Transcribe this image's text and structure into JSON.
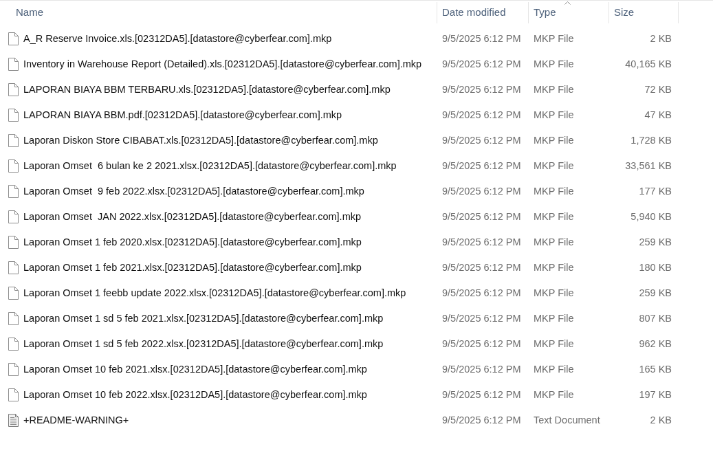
{
  "table": {
    "columns": [
      {
        "label": "Name",
        "sorted": false
      },
      {
        "label": "Date modified",
        "sorted": false
      },
      {
        "label": "Type",
        "sorted": true
      },
      {
        "label": "Size",
        "sorted": false
      }
    ],
    "rows": [
      {
        "kind": "file",
        "name": "A_R Reserve Invoice.xls.[02312DA5].[datastore@cyberfear.com].mkp",
        "date": "9/5/2025 6:12 PM",
        "type": "MKP File",
        "size": "2 KB"
      },
      {
        "kind": "file",
        "name": "Inventory in Warehouse Report (Detailed).xls.[02312DA5].[datastore@cyberfear.com].mkp",
        "date": "9/5/2025 6:12 PM",
        "type": "MKP File",
        "size": "40,165 KB"
      },
      {
        "kind": "file",
        "name": "LAPORAN BIAYA BBM TERBARU.xls.[02312DA5].[datastore@cyberfear.com].mkp",
        "date": "9/5/2025 6:12 PM",
        "type": "MKP File",
        "size": "72 KB"
      },
      {
        "kind": "file",
        "name": "LAPORAN BIAYA BBM.pdf.[02312DA5].[datastore@cyberfear.com].mkp",
        "date": "9/5/2025 6:12 PM",
        "type": "MKP File",
        "size": "47 KB"
      },
      {
        "kind": "file",
        "name": "Laporan Diskon Store CIBABAT.xls.[02312DA5].[datastore@cyberfear.com].mkp",
        "date": "9/5/2025 6:12 PM",
        "type": "MKP File",
        "size": "1,728 KB"
      },
      {
        "kind": "file",
        "name": "Laporan Omset  6 bulan ke 2 2021.xlsx.[02312DA5].[datastore@cyberfear.com].mkp",
        "date": "9/5/2025 6:12 PM",
        "type": "MKP File",
        "size": "33,561 KB"
      },
      {
        "kind": "file",
        "name": "Laporan Omset  9 feb 2022.xlsx.[02312DA5].[datastore@cyberfear.com].mkp",
        "date": "9/5/2025 6:12 PM",
        "type": "MKP File",
        "size": "177 KB"
      },
      {
        "kind": "file",
        "name": "Laporan Omset  JAN 2022.xlsx.[02312DA5].[datastore@cyberfear.com].mkp",
        "date": "9/5/2025 6:12 PM",
        "type": "MKP File",
        "size": "5,940 KB"
      },
      {
        "kind": "file",
        "name": "Laporan Omset 1 feb 2020.xlsx.[02312DA5].[datastore@cyberfear.com].mkp",
        "date": "9/5/2025 6:12 PM",
        "type": "MKP File",
        "size": "259 KB"
      },
      {
        "kind": "file",
        "name": "Laporan Omset 1 feb 2021.xlsx.[02312DA5].[datastore@cyberfear.com].mkp",
        "date": "9/5/2025 6:12 PM",
        "type": "MKP File",
        "size": "180 KB"
      },
      {
        "kind": "file",
        "name": "Laporan Omset 1 feebb update 2022.xlsx.[02312DA5].[datastore@cyberfear.com].mkp",
        "date": "9/5/2025 6:12 PM",
        "type": "MKP File",
        "size": "259 KB"
      },
      {
        "kind": "file",
        "name": "Laporan Omset 1 sd 5 feb 2021.xlsx.[02312DA5].[datastore@cyberfear.com].mkp",
        "date": "9/5/2025 6:12 PM",
        "type": "MKP File",
        "size": "807 KB"
      },
      {
        "kind": "file",
        "name": "Laporan Omset 1 sd 5 feb 2022.xlsx.[02312DA5].[datastore@cyberfear.com].mkp",
        "date": "9/5/2025 6:12 PM",
        "type": "MKP File",
        "size": "962 KB"
      },
      {
        "kind": "file",
        "name": "Laporan Omset 10 feb 2021.xlsx.[02312DA5].[datastore@cyberfear.com].mkp",
        "date": "9/5/2025 6:12 PM",
        "type": "MKP File",
        "size": "165 KB"
      },
      {
        "kind": "file",
        "name": "Laporan Omset 10 feb 2022.xlsx.[02312DA5].[datastore@cyberfear.com].mkp",
        "date": "9/5/2025 6:12 PM",
        "type": "MKP File",
        "size": "197 KB"
      },
      {
        "kind": "text_document",
        "name": "+README-WARNING+",
        "date": "9/5/2025 6:12 PM",
        "type": "Text Document",
        "size": "2 KB"
      }
    ]
  }
}
